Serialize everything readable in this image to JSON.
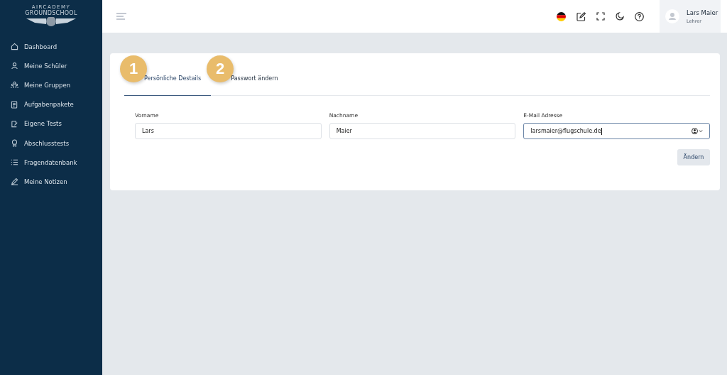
{
  "logo": {
    "line_1": "AIRCADEMY",
    "line_2": "GROUNDSCHOOL"
  },
  "sidebar": {
    "items": [
      {
        "label": "Dashboard",
        "selected": false
      },
      {
        "label": "Meine Schüler",
        "selected": false
      },
      {
        "label": "Meine Gruppen",
        "selected": false
      },
      {
        "label": "Aufgabenpakete",
        "selected": false
      },
      {
        "label": "Eigene Tests",
        "selected": false
      },
      {
        "label": "Abschlusstests",
        "selected": false
      },
      {
        "label": "Fragendatenbank",
        "selected": false
      },
      {
        "label": "Meine Notizen",
        "selected": false
      }
    ]
  },
  "user": {
    "name": "Lars Maier",
    "role": "Lehrer"
  },
  "tabs": [
    {
      "label": "Persönliche Destails",
      "selected": true,
      "badge": "1"
    },
    {
      "label": "Passwort ändern",
      "selected": false,
      "badge": "2"
    }
  ],
  "fields": [
    {
      "label": "Vorname",
      "value": "Lars",
      "focused": false,
      "kind": "text"
    },
    {
      "label": "Nachname",
      "value": "Maier",
      "focused": false,
      "kind": "text"
    },
    {
      "label": "E-Mail Adresse",
      "value": "larsmaier@flugschule.de",
      "focused": true,
      "kind": "email"
    }
  ],
  "submit_button": "Ändern"
}
